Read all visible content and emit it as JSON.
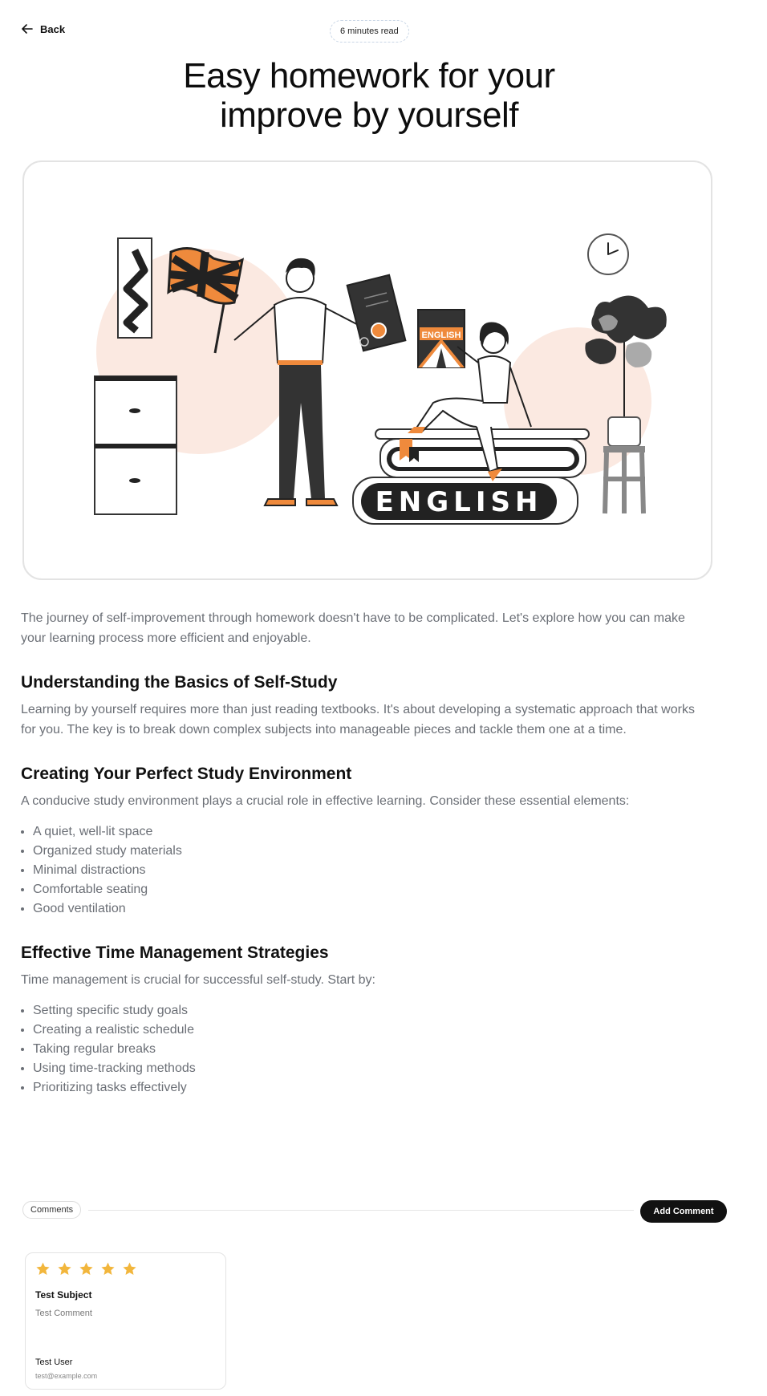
{
  "header": {
    "back_label": "Back",
    "read_time": "6 minutes read",
    "title_line1": "Easy homework for your",
    "title_line2": "improve by yourself"
  },
  "hero": {
    "book_word": "ENGLISH",
    "badge_word": "ENGLISH",
    "accent_color": "#ef8a3c",
    "blob_color": "#fbe9e1"
  },
  "article": {
    "intro": "The journey of self-improvement through homework doesn't have to be complicated. Let's explore how you can make your learning process more efficient and enjoyable.",
    "sections": [
      {
        "heading": "Understanding the Basics of Self-Study",
        "text": "Learning by yourself requires more than just reading textbooks. It's about developing a systematic approach that works for you. The key is to break down complex subjects into manageable pieces and tackle them one at a time.",
        "items": []
      },
      {
        "heading": "Creating Your Perfect Study Environment",
        "text": "A conducive study environment plays a crucial role in effective learning. Consider these essential elements:",
        "items": [
          "A quiet, well-lit space",
          "Organized study materials",
          "Minimal distractions",
          "Comfortable seating",
          "Good ventilation"
        ]
      },
      {
        "heading": "Effective Time Management Strategies",
        "text": "Time management is crucial for successful self-study. Start by:",
        "items": [
          "Setting specific study goals",
          "Creating a realistic schedule",
          "Taking regular breaks",
          "Using time-tracking methods",
          "Prioritizing tasks effectively"
        ]
      }
    ]
  },
  "comments": {
    "label": "Comments",
    "add_button": "Add Comment",
    "star_color": "#f2b63c",
    "list": [
      {
        "rating": 5,
        "subject": "Test Subject",
        "body": "Test Comment",
        "user": "Test User",
        "email": "test@example.com"
      }
    ]
  }
}
